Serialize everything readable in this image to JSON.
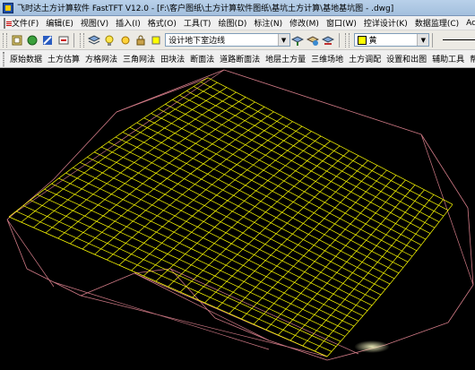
{
  "window": {
    "title": "飞时达土方计算软件 FastTFT V12.0 - [F:\\客户图纸\\土方计算软件图纸\\基坑土方计算\\基地基坑图 - .dwg]"
  },
  "menu": [
    {
      "id": "file",
      "label": "文件(F)"
    },
    {
      "id": "edit",
      "label": "编辑(E)"
    },
    {
      "id": "view",
      "label": "视图(V)"
    },
    {
      "id": "insert",
      "label": "插入(I)"
    },
    {
      "id": "format",
      "label": "格式(O)"
    },
    {
      "id": "tools",
      "label": "工具(T)"
    },
    {
      "id": "draw",
      "label": "绘图(D)"
    },
    {
      "id": "dimension",
      "label": "标注(N)"
    },
    {
      "id": "modify",
      "label": "修改(M)"
    },
    {
      "id": "window",
      "label": "窗口(W)"
    },
    {
      "id": "control",
      "label": "控详设计(K)"
    },
    {
      "id": "data",
      "label": "数据监理(C)"
    },
    {
      "id": "acrobat",
      "label": "Acrob"
    }
  ],
  "toolbar": {
    "layer_value": "设计地下室边线",
    "color_value": "黄",
    "color_hex": "#ffff00"
  },
  "ribbon": [
    {
      "id": "raw-data",
      "label": "原始数据"
    },
    {
      "id": "earth-estimate",
      "label": "土方估算"
    },
    {
      "id": "grid-method",
      "label": "方格网法"
    },
    {
      "id": "triangle-method",
      "label": "三角网法"
    },
    {
      "id": "block-method",
      "label": "田块法"
    },
    {
      "id": "section-method",
      "label": "断面法"
    },
    {
      "id": "road-section",
      "label": "道路断面法"
    },
    {
      "id": "layer-volume",
      "label": "地层土方量"
    },
    {
      "id": "3d-site",
      "label": "三维场地"
    },
    {
      "id": "earth-balance",
      "label": "土方调配"
    },
    {
      "id": "settings-output",
      "label": "设置和出图"
    },
    {
      "id": "aux-tools",
      "label": "辅助工具"
    },
    {
      "id": "help",
      "label": "帮助"
    }
  ],
  "colors": {
    "mesh": "#ffff00",
    "terrain": "#d17a86",
    "background": "#000000"
  }
}
